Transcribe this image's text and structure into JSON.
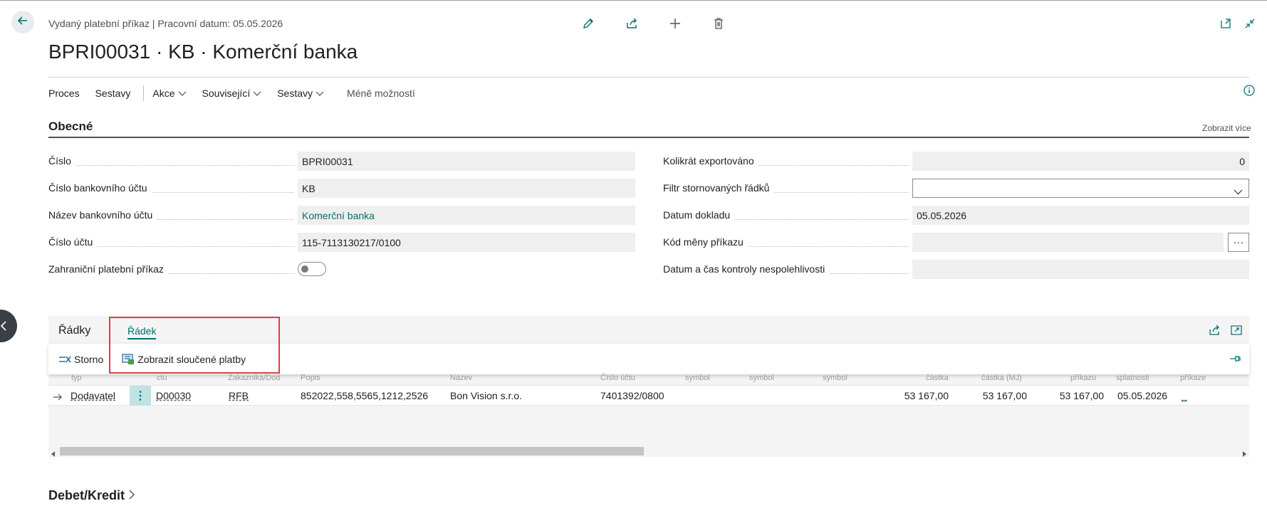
{
  "header": {
    "breadcrumb": "Vydaný platební příkaz | Pracovní datum: 05.05.2026",
    "title": "BPRI00031 · KB · Komerční banka"
  },
  "menu": {
    "items": [
      {
        "label": "Proces"
      },
      {
        "label": "Sestavy"
      },
      {
        "label": "Akce"
      },
      {
        "label": "Související"
      },
      {
        "label": "Sestavy"
      }
    ],
    "less": "Méně možností"
  },
  "general": {
    "title": "Obecné",
    "show_more": "Zobrazit více",
    "left": [
      {
        "label": "Číslo",
        "value": "BPRI00031"
      },
      {
        "label": "Číslo bankovního účtu",
        "value": "KB"
      },
      {
        "label": "Název bankovního účtu",
        "value": "Komerční banka"
      },
      {
        "label": "Číslo účtu",
        "value": "115-7113130217/0100"
      },
      {
        "label": "Zahraniční platební příkaz"
      }
    ],
    "right": [
      {
        "label": "Kolikrát exportováno",
        "value": "0"
      },
      {
        "label": "Filtr stornovaných řádků",
        "value": ""
      },
      {
        "label": "Datum dokladu",
        "value": "05.05.2026"
      },
      {
        "label": "Kód měny příkazu",
        "value": ""
      },
      {
        "label": "Datum a čas kontroly nespolehlivosti",
        "value": ""
      }
    ],
    "ellipsis": "···"
  },
  "lines": {
    "title": "Řádky",
    "tab": "Řádek",
    "actions": {
      "storno": "Storno",
      "show_merged": "Zobrazit sloučené platby"
    },
    "header_fragments": [
      "typ",
      "ctu",
      "Zakaznika/Dod",
      "Popis",
      "Název",
      "Číslo účtu",
      "symbol",
      "symbol",
      "symbol",
      "částka",
      "částka (MJ)",
      "příkazu",
      "splatnosti",
      "příkaze"
    ],
    "row": {
      "type": "Dodavatel",
      "dots": "⋮",
      "no": "D00030",
      "code": "RFB",
      "description": "852022,558,5565,1212,2526",
      "name": "Bon Vision s.r.o.",
      "account": "7401392/0800",
      "amount1": "53 167,00",
      "amount2": "53 167,00",
      "amount3": "53 167,00",
      "due_date": "05.05.2026",
      "last": "_"
    }
  },
  "debit": {
    "title": "Debet/Kredit"
  },
  "colors": {
    "accent": "#00706e",
    "highlight_box": "#e03e3e"
  }
}
